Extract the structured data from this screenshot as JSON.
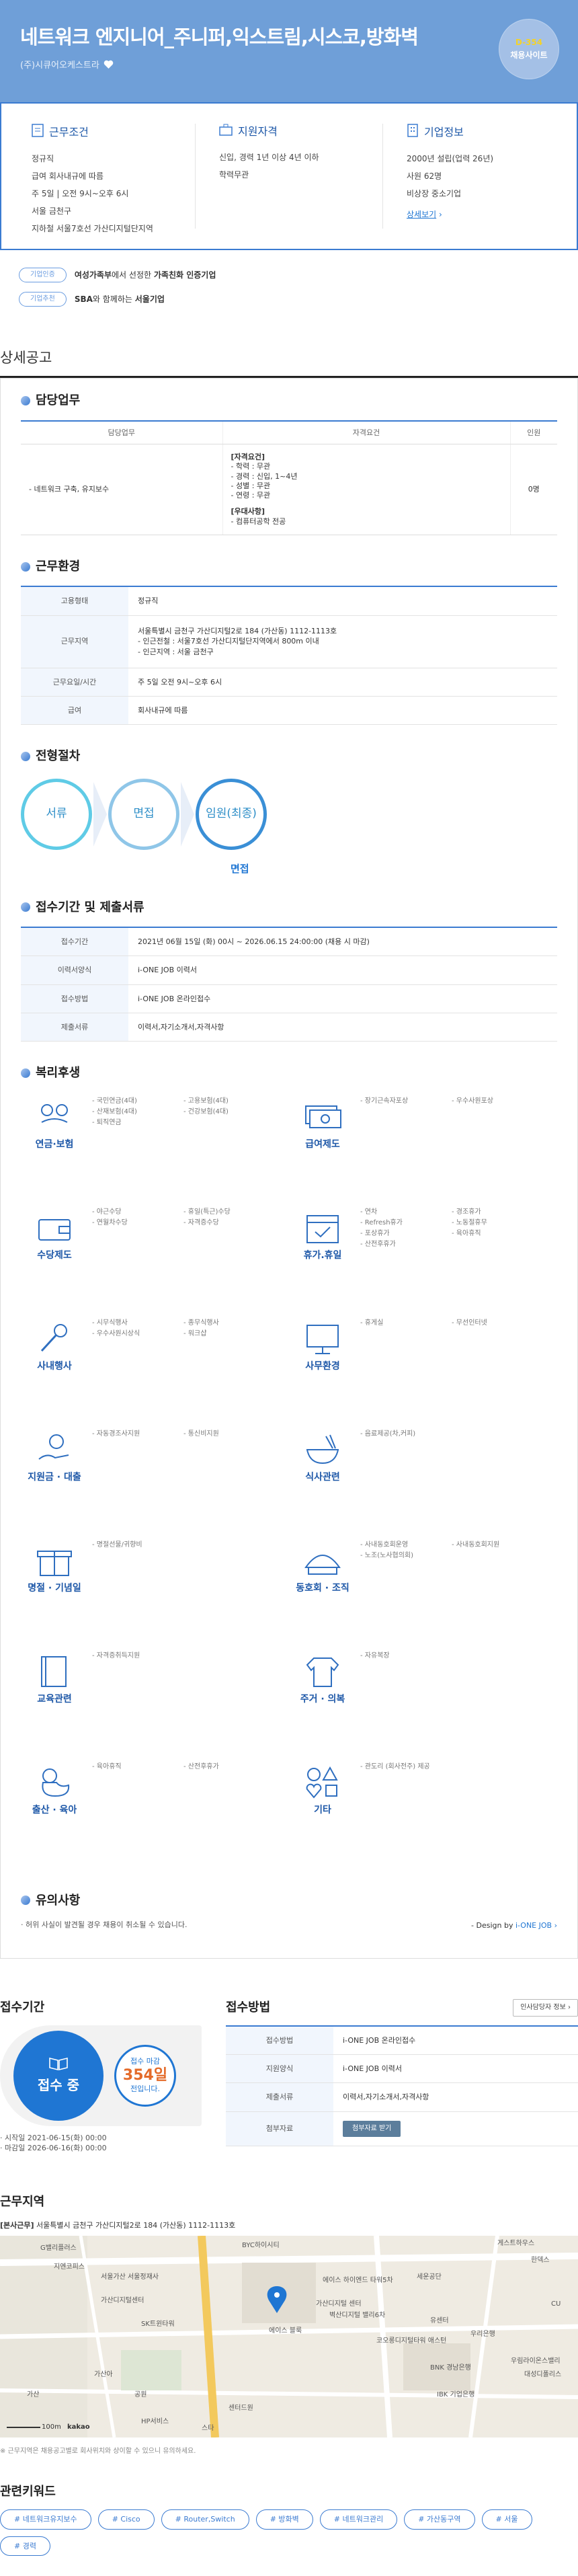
{
  "hero": {
    "title": "네트워크 엔지니어_주니퍼,익스트림,시스코,방화벽",
    "company": "(주)시큐어오케스트라",
    "dday": "D-354",
    "dday_label": "채용사이트"
  },
  "summary": {
    "work": {
      "title": "근무조건",
      "lines": [
        "정규직",
        "급여 회사내규에 따름",
        "주 5일 | 오전 9시~오후 6시",
        "서울 금천구",
        "지하철 서울7호선 가산디지털단지역"
      ]
    },
    "qual": {
      "title": "지원자격",
      "lines": [
        "신입, 경력 1년 이상 4년 이하",
        "학력무관"
      ]
    },
    "corp": {
      "title": "기업정보",
      "lines": [
        "2000년 설립(업력 26년)",
        "사원 62명",
        "비상장 중소기업"
      ],
      "link": "상세보기"
    }
  },
  "badges": [
    {
      "tag": "기업인증",
      "prefix": "여성가족부",
      "mid": "에서 선정한 ",
      "name": "가족친화 인증기업"
    },
    {
      "tag": "기업추천",
      "prefix": "SBA",
      "mid": "와 함께하는 ",
      "name": "서울기업"
    }
  ],
  "detail_title": "상세공고",
  "duty": {
    "title": "담당업무",
    "headers": [
      "담당업무",
      "자격요건",
      "인원"
    ],
    "row": {
      "task": "- 네트워크 구축, 유지보수",
      "q1": "[자격요건]",
      "q2": "- 학력 : 무관",
      "q3": "- 경력 : 신입, 1~4년",
      "q4": "- 성별 : 무관",
      "q5": "- 연령 : 무관",
      "q6": "[우대사항]",
      "q7": "- 컴퓨터공학 전공",
      "count": "0명"
    }
  },
  "env": {
    "title": "근무환경",
    "rows": [
      {
        "k": "고용형태",
        "v": "정규직"
      },
      {
        "k": "근무지역",
        "v": "서울특별시 금천구 가산디지털2로 184 (가산동) 1112-1113호",
        "v2": "- 인근전철 : 서울7호선 가산디지털단지역에서 800m 이내",
        "v3": "- 인근지역 : 서울 금천구"
      },
      {
        "k": "근무요일/시간",
        "v": "주 5일 오전 9시~오후 6시"
      },
      {
        "k": "급여",
        "v": "회사내규에 따름"
      }
    ]
  },
  "process": {
    "title": "전형절차",
    "steps": [
      "서류",
      "면접",
      "임원(최종)"
    ],
    "pass": "면접"
  },
  "apply": {
    "title": "접수기간 및 제출서류",
    "rows": [
      {
        "k": "접수기간",
        "v": "2021년 06월 15일 (화) 00시 ~ 2026.06.15 24:00:00 (채용 시 마감)"
      },
      {
        "k": "이력서양식",
        "v": "i-ONE JOB 이력서"
      },
      {
        "k": "접수방법",
        "v": "i-ONE JOB 온라인접수"
      },
      {
        "k": "제출서류",
        "v": "이력서,자기소개서,자격사항"
      }
    ]
  },
  "welfare": {
    "title": "복리후생",
    "items": [
      {
        "name": "연금·보험",
        "icon": "glasses-mustache-icon",
        "list": [
          "국민연금(4대)",
          "고용보험(4대)",
          "산재보험(4대)",
          "건강보험(4대)",
          "퇴직연금"
        ]
      },
      {
        "name": "급여제도",
        "icon": "money-bills-icon",
        "list": [
          "장기근속자포상",
          "우수사원포상"
        ]
      },
      {
        "name": "수당제도",
        "icon": "wallet-icon",
        "list": [
          "야근수당",
          "휴일(특근)수당",
          "연월차수당",
          "자격증수당"
        ]
      },
      {
        "name": "휴가.휴일",
        "icon": "calendar-check-icon",
        "list": [
          "연차",
          "경조휴가",
          "Refresh휴가",
          "노동절휴무",
          "포상휴가",
          "육아휴직",
          "산전후휴가"
        ]
      },
      {
        "name": "사내행사",
        "icon": "microphone-icon",
        "list": [
          "시무식행사",
          "종무식행사",
          "우수사원시상식",
          "워크샵"
        ]
      },
      {
        "name": "사무환경",
        "icon": "monitor-icon",
        "list": [
          "휴게실",
          "무선인터넷"
        ]
      },
      {
        "name": "지원금 · 대출",
        "icon": "coin-hand-icon",
        "list": [
          "자동경조사지원",
          "통신비지원"
        ]
      },
      {
        "name": "식사관련",
        "icon": "bowl-icon",
        "list": [
          "음료제공(차,커피)"
        ]
      },
      {
        "name": "명절 · 기념일",
        "icon": "gift-icon",
        "list": [
          "명절선물/귀향비"
        ]
      },
      {
        "name": "동호회 · 조직",
        "icon": "group-icon",
        "list": [
          "사내동호회운영",
          "사내동호회지원",
          "노조(노사협의회)"
        ]
      },
      {
        "name": "교육관련",
        "icon": "book-icon",
        "list": [
          "자격증취득지원"
        ]
      },
      {
        "name": "주거 · 의복",
        "icon": "shirt-icon",
        "list": [
          "자유복장"
        ]
      },
      {
        "name": "출산 · 육아",
        "icon": "duck-icon",
        "list": [
          "육아휴직",
          "산전후휴가"
        ]
      },
      {
        "name": "기타",
        "icon": "shapes-icon",
        "list": [
          "관도리 (회사전주) 제공"
        ]
      }
    ]
  },
  "notes": {
    "title": "유의사항",
    "text": "· 허위 사실이 발견될 경우 채용이 취소될 수 있습니다.",
    "design": "- Design by",
    "design_brand": "i-ONE JOB"
  },
  "reception": {
    "title": "접수기간",
    "status": "접수 중",
    "dday_top": "접수 마감",
    "dday_num": "354일",
    "dday_bottom": "전입니다.",
    "start": "· 시작일 2021-06-15(화) 00:00",
    "end": "· 마감일 2026-06-16(화) 00:00"
  },
  "method": {
    "title": "접수방법",
    "button": "인사담당자 정보",
    "rows": [
      {
        "k": "접수방법",
        "v": "i-ONE JOB 온라인접수"
      },
      {
        "k": "지원양식",
        "v": "i-ONE JOB 이력서"
      },
      {
        "k": "제출서류",
        "v": "이력서,자기소개서,자격사항"
      },
      {
        "k": "첨부자료",
        "v": "첨부자료 받기"
      }
    ]
  },
  "location": {
    "title": "근무지역",
    "addr_label": "[본사근무]",
    "addr": "서울특별시 금천구 가산디지털2로 184 (가산동) 1112-1113호",
    "note": "※ 근무지역은 채용공고별로 회사위치와 상이할 수 있으니 유의하세요.",
    "map_labels": [
      "G밸리플러스",
      "BYC하이시티",
      "지엔코피스",
      "서울가산 서울정재사",
      "가산디지털센터",
      "SK트윈타워",
      "에이스 하이엔드 타워5차",
      "세운공단",
      "가산디지털 센터",
      "벽산디지털 밸리6차",
      "유센터",
      "우리은행",
      "BNK 경남은행",
      "IBK 기업은행",
      "에이스 블룩",
      "센터드원",
      "HP서비스",
      "게스트하우스",
      "한덱스",
      "CU",
      "우림라이온스밸리",
      "대성디폴리스",
      "코오롱디지털타워 애스턴",
      "가산아",
      "가산",
      "공원",
      "스타"
    ],
    "scale": "100m",
    "brand": "kakao"
  },
  "keywords": {
    "title": "관련키워드",
    "tags": [
      "# 네트워크유지보수",
      "# Cisco",
      "# Router,Switch",
      "# 방화벽",
      "# 네트워크관리",
      "# 가산동구역",
      "# 서울",
      "# 경력"
    ]
  }
}
